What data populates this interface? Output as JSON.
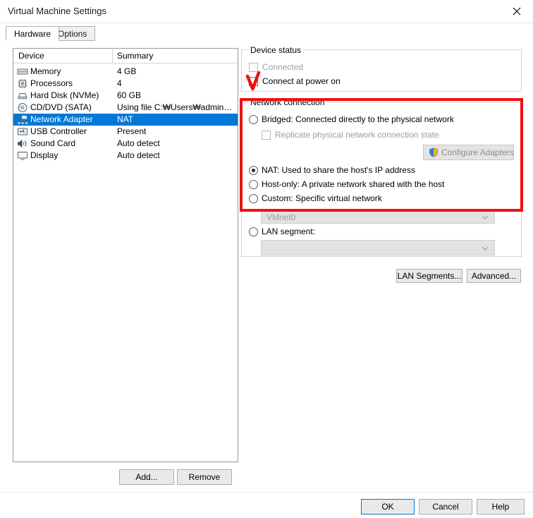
{
  "window": {
    "title": "Virtual Machine Settings",
    "close_icon": "close-x-icon"
  },
  "tabs": [
    {
      "label": "Hardware",
      "active": true
    },
    {
      "label": "Options",
      "active": false
    }
  ],
  "device_list": {
    "columns": [
      "Device",
      "Summary"
    ],
    "rows": [
      {
        "icon": "memory-icon",
        "device": "Memory",
        "summary": "4 GB",
        "selected": false
      },
      {
        "icon": "processor-icon",
        "device": "Processors",
        "summary": "4",
        "selected": false
      },
      {
        "icon": "hard-disk-icon",
        "device": "Hard Disk (NVMe)",
        "summary": "60 GB",
        "selected": false
      },
      {
        "icon": "cd-dvd-icon",
        "device": "CD/DVD (SATA)",
        "summary": "Using file C:₩Users₩admin…",
        "selected": false
      },
      {
        "icon": "network-adapter-icon",
        "device": "Network Adapter",
        "summary": "NAT",
        "selected": true
      },
      {
        "icon": "usb-controller-icon",
        "device": "USB Controller",
        "summary": "Present",
        "selected": false
      },
      {
        "icon": "sound-card-icon",
        "device": "Sound Card",
        "summary": "Auto detect",
        "selected": false
      },
      {
        "icon": "display-icon",
        "device": "Display",
        "summary": "Auto detect",
        "selected": false
      }
    ],
    "add_label": "Add...",
    "remove_label": "Remove"
  },
  "device_status": {
    "legend": "Device status",
    "connected": {
      "label": "Connected",
      "checked": false,
      "enabled": false
    },
    "connect_at_power_on": {
      "label": "Connect at power on",
      "checked": false,
      "enabled": true
    }
  },
  "network_connection": {
    "legend": "Network connection",
    "options": [
      {
        "label": "Bridged: Connected directly to the physical network",
        "selected": false
      },
      {
        "label": "NAT: Used to share the host's IP address",
        "selected": true
      },
      {
        "label": "Host-only: A private network shared with the host",
        "selected": false
      },
      {
        "label": "Custom: Specific virtual network",
        "selected": false
      },
      {
        "label": "LAN segment:",
        "selected": false
      }
    ],
    "replicate_state": {
      "label": "Replicate physical network connection state",
      "checked": false,
      "enabled": false
    },
    "configure_adapters": {
      "label": "Configure Adapters",
      "icon": "uac-shield-icon",
      "enabled": false
    },
    "custom_network_value": "VMnet0",
    "lan_segment_value": "",
    "lan_segments_label": "LAN Segments...",
    "advanced_label": "Advanced..."
  },
  "footer": {
    "ok_label": "OK",
    "cancel_label": "Cancel",
    "help_label": "Help"
  },
  "annotations": {
    "highlight_color": "#ee1111",
    "check_mark": "hand-drawn-check-mark",
    "rectangle": "hand-drawn-rectangle-around-network-connection"
  }
}
